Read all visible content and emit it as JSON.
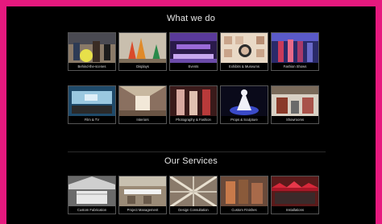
{
  "sections": [
    {
      "title": "What we do"
    },
    {
      "title": "Our Services"
    }
  ],
  "row1": [
    "Behind-the-scenes",
    "Displays",
    "Events",
    "Exhibits & Museums",
    "Fashion Shows"
  ],
  "row2": [
    "Film & TV",
    "Interiors",
    "Photography & Fashion",
    "Props & Sculpture",
    "Showrooms"
  ],
  "row3": [
    "Custom Fabrication",
    "Project Management",
    "Design Consultation",
    "Custom Finishes",
    "Installations"
  ],
  "colors": {
    "frame": "#e6197e",
    "background": "#000000",
    "text": "#e8e8e8"
  }
}
